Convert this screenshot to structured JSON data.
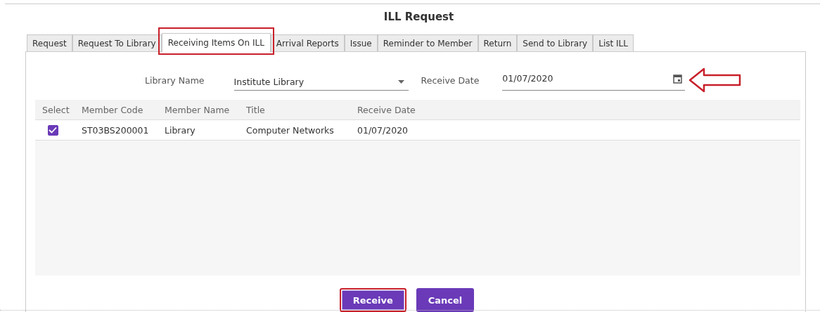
{
  "title": "ILL Request",
  "tabs": [
    {
      "label": "Request",
      "selected": false,
      "highlighted": false
    },
    {
      "label": "Request To Library",
      "selected": false,
      "highlighted": false
    },
    {
      "label": "Receiving Items On ILL",
      "selected": true,
      "highlighted": true
    },
    {
      "label": "Arrival Reports",
      "selected": false,
      "highlighted": false
    },
    {
      "label": "Issue",
      "selected": false,
      "highlighted": false
    },
    {
      "label": "Reminder to Member",
      "selected": false,
      "highlighted": false
    },
    {
      "label": "Return",
      "selected": false,
      "highlighted": false
    },
    {
      "label": "Send  to Library",
      "selected": false,
      "highlighted": false
    },
    {
      "label": "List ILL",
      "selected": false,
      "highlighted": false
    }
  ],
  "library_name": {
    "label": "Library Name",
    "value": "Institute Library"
  },
  "receive_date": {
    "label": "Receive Date",
    "value": "01/07/2020",
    "arrow_annotation": true
  },
  "table": {
    "columns": [
      "Select",
      "Member Code",
      "Member Name",
      "Title",
      "Receive Date"
    ],
    "rows": [
      {
        "selected": true,
        "cells": [
          "",
          "ST03BS200001",
          "Library",
          "Computer Networks",
          "01/07/2020"
        ]
      }
    ]
  },
  "buttons": [
    {
      "label": "Receive",
      "highlighted": true
    },
    {
      "label": "Cancel",
      "highlighted": false
    }
  ]
}
